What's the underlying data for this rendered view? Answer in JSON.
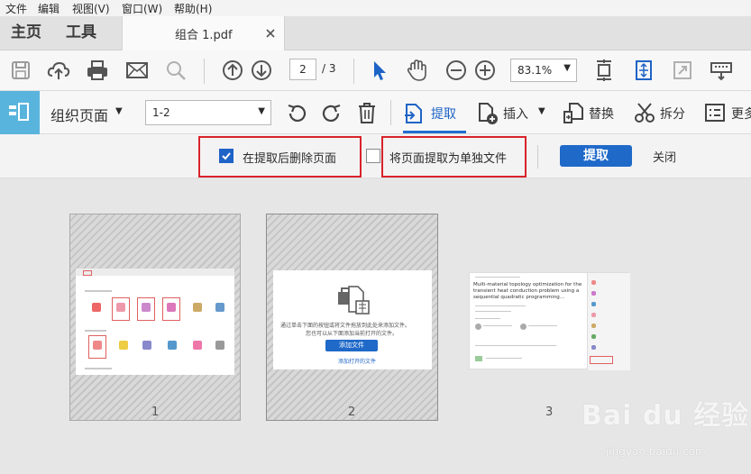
{
  "menu": [
    "文件",
    "编辑",
    "视图(V)",
    "窗口(W)",
    "帮助(H)"
  ],
  "tabs": {
    "home": "主页",
    "tools": "工具",
    "document": "组合 1.pdf"
  },
  "toolbar": {
    "current_page": "2",
    "page_total": "/ 3",
    "zoom": "83.1%"
  },
  "organize": {
    "title": "组织页面",
    "range": "1-2",
    "extract": "提取",
    "insert": "插入",
    "replace": "替换",
    "split": "拆分",
    "more": "更多"
  },
  "options": {
    "delete_after_extract": {
      "label": "在提取后删除页面",
      "checked": true
    },
    "extract_as_separate": {
      "label": "将页面提取为单独文件",
      "checked": false
    },
    "extract_button": "提取",
    "close": "关闭"
  },
  "pages": [
    {
      "number": "1"
    },
    {
      "number": "2",
      "drop_text_1": "通过单击下面的按钮或将文件拖放到此处来添加文件。",
      "drop_text_2": "您也可以从下面添加当前打开的文件。",
      "add_button": "添加文件",
      "add_open": "添加打开的文件"
    },
    {
      "number": "3",
      "article_title": "Multi-material topology optimization for the transient heat conduction problem using a sequential quadratic programming..."
    }
  ],
  "watermark": {
    "logo": "Bai du 经验",
    "url": "jingyan.baidu.com"
  },
  "colors": {
    "accent": "#1f69c9",
    "highlight_border": "#d8232a",
    "organize_icon_bg": "#59b4dd"
  }
}
